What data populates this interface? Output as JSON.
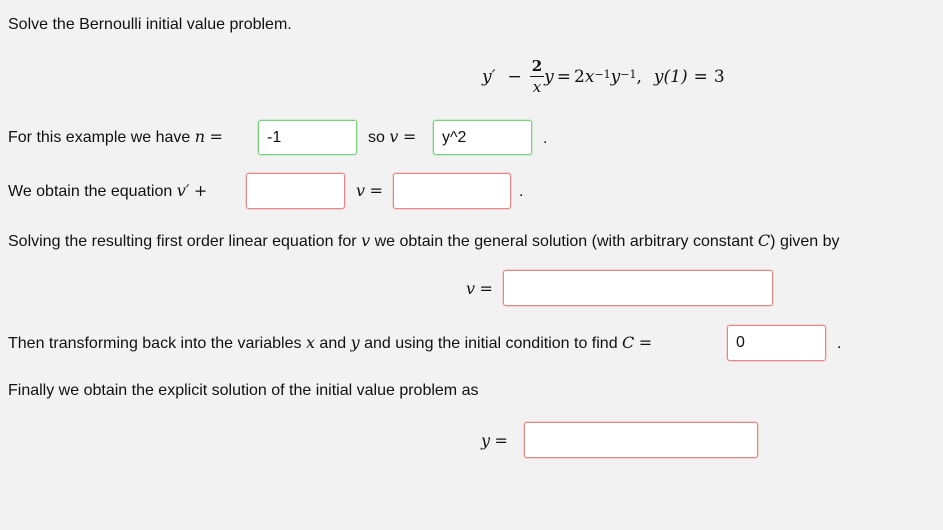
{
  "title": "Solve the Bernoulli initial value problem.",
  "equation": {
    "lhs_y": "y′",
    "minus": "−",
    "frac_num": "2",
    "frac_den": "x",
    "y": "y",
    "eq": "=",
    "coef": "2",
    "x": "x",
    "x_exp": "−1",
    "y2": "y",
    "y_exp": "−1",
    "comma": ",",
    "ic_lhs": "y(1)",
    "ic_eq": "=",
    "ic_rhs": "3"
  },
  "line_n": {
    "prefix": "For this example we have",
    "n_var": "n",
    "eq": "=",
    "n_value": "-1",
    "so": "so",
    "v_var": "v",
    "eq2": "=",
    "v_value": "y^2",
    "period": "."
  },
  "line_eq": {
    "prefix": "We obtain the equation",
    "vprime": "v′",
    "plus": "+",
    "v_var": "v",
    "eq": "=",
    "coef_value": "",
    "rhs_value": "",
    "period": "."
  },
  "line_general": {
    "text_before": "Solving the resulting first order linear equation for",
    "v_var": "v",
    "text_middle": "we obtain the general solution (with arbitrary constant",
    "c_var": "C",
    "text_after": ") given by"
  },
  "general_solution": {
    "v_var": "v",
    "eq": "=",
    "value": ""
  },
  "line_c": {
    "text_before": "Then transforming back into the variables",
    "x_var": "x",
    "and": "and",
    "y_var": "y",
    "text_after": "and using the initial condition to find",
    "c_var": "C",
    "eq": "=",
    "c_value": "0",
    "period": "."
  },
  "line_final": {
    "text": "Finally we obtain the explicit solution of the initial value problem as"
  },
  "final_solution": {
    "y_var": "y",
    "eq": "=",
    "value": ""
  }
}
